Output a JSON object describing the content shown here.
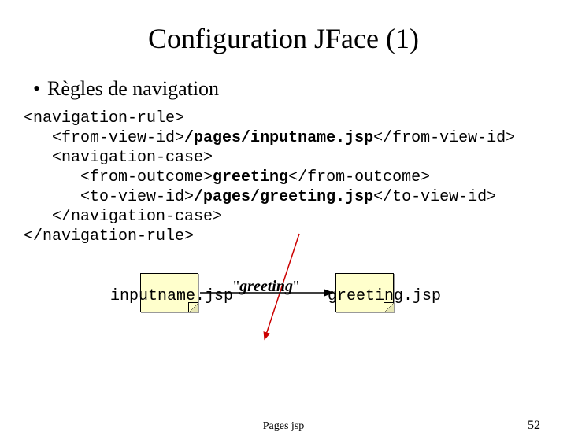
{
  "title": "Configuration JFace (1)",
  "bullet": "Règles de navigation",
  "code": {
    "l1": "<navigation-rule>",
    "l2a": "   <from-view-id>",
    "l2bold": "/pages/inputname.jsp",
    "l2b": "</from-view-id>",
    "l3": "   <navigation-case>",
    "l4a": "      <from-outcome>",
    "l4bold": "greeting",
    "l4b": "</from-outcome>",
    "l5a": "      <to-view-id>",
    "l5bold": "/pages/greeting.jsp",
    "l5b": "</to-view-id>",
    "l6": "   </navigation-case>",
    "l7": "</navigation-rule>"
  },
  "diagram": {
    "left_label": "inputname.jsp",
    "right_label": "greeting.jsp",
    "edge_quote": "\"",
    "edge_word": "greeting"
  },
  "footer": {
    "center": "Pages jsp",
    "page": "52"
  }
}
